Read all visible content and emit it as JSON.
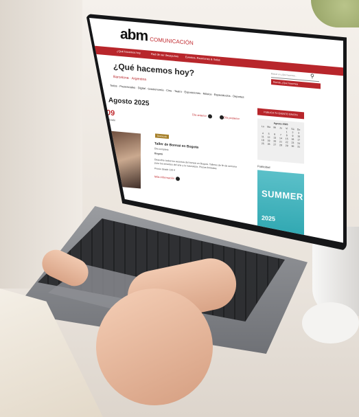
{
  "logo": {
    "brand": "abm",
    "tagline": "COMUNICACIÓN"
  },
  "nav": {
    "items": [
      "¿Qué hacemos hoy",
      "Red de ver desayunos",
      "Eventos, Reuniones & Salas"
    ]
  },
  "header": {
    "title": "¿Qué hacemos hoy?",
    "search_placeholder": "Buscar en ¿Qué hacemos...",
    "subnav_label": "Red de ¿Qué hacemos"
  },
  "region": {
    "label": "Barcelona · Argentina"
  },
  "categories": [
    "Todos",
    "Presenciales",
    "Digital",
    "Gastronomía",
    "Cine",
    "Teatro",
    "Exposiciones",
    "Música",
    "Espectáculos",
    "Deportes"
  ],
  "month": {
    "label": "Agosto 2025"
  },
  "day": {
    "number": "09",
    "name": "sábado"
  },
  "event": {
    "badge": "Destacado",
    "title": "Taller de Bonsai en Bogota",
    "subtitle": "Día completo",
    "location": "Bogotá",
    "desc_1": "Descubre todos los secretos del bonsai en Bogotá. Talleres de fin de semana",
    "desc_2": "para los amantes del arte y la naturaleza. Plazas limitadas",
    "price": "Precio desde 120 €",
    "more": "Más información",
    "prev_link": "Día anterior",
    "next_link": "Día posterior"
  },
  "sidebar": {
    "button": "PUBLICA TU EVENTO GRATIS",
    "calendar_month": "Agosto 2025",
    "weekdays": [
      "Lu",
      "Ma",
      "Mi",
      "Ju",
      "Vi",
      "Sá",
      "Do"
    ],
    "days": [
      "",
      "",
      "",
      "",
      "1",
      "2",
      "3",
      "4",
      "5",
      "6",
      "7",
      "8",
      "9",
      "10",
      "11",
      "12",
      "13",
      "14",
      "15",
      "16",
      "17",
      "18",
      "19",
      "20",
      "21",
      "22",
      "23",
      "24",
      "25",
      "26",
      "27",
      "28",
      "29",
      "30",
      "31"
    ],
    "pub_label": "Publicidad",
    "poster_title": "SUMMER",
    "poster_year": "2025"
  }
}
